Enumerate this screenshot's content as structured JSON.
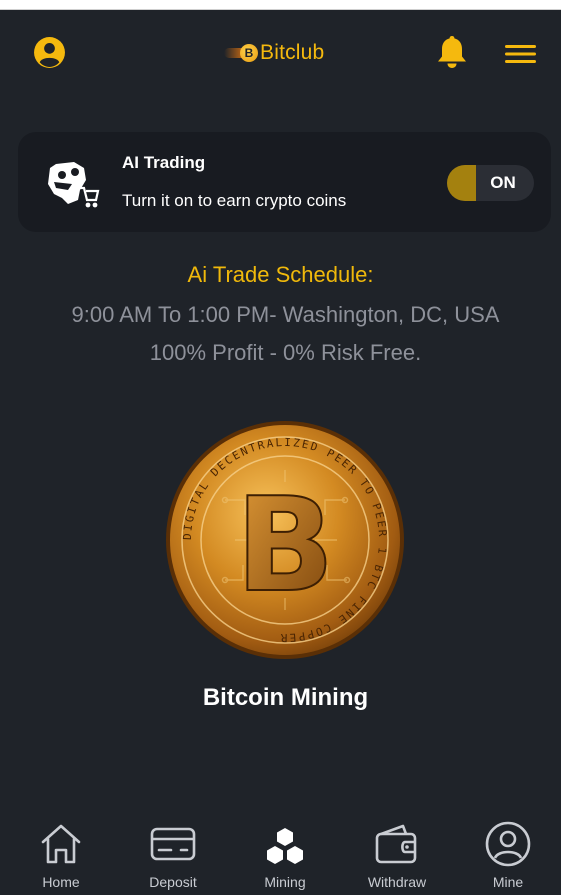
{
  "header": {
    "profile_icon": "user-circle-icon",
    "logo_text": "Bitclub",
    "logo_coin_glyph": "B",
    "notification_icon": "bell-icon",
    "menu_icon": "hamburger-icon"
  },
  "ai_card": {
    "icon": "robot-cart-icon",
    "title": "AI Trading",
    "subtitle": "Turn it on to earn crypto coins",
    "toggle_label": "ON",
    "toggle_on": true
  },
  "schedule": {
    "title": "Ai Trade Schedule:",
    "time": "9:00 AM To 1:00 PM- Washington, DC, USA",
    "profit": "100% Profit - 0% Risk Free."
  },
  "hero": {
    "image": "bitcoin-coin-image",
    "caption": "Bitcoin Mining",
    "coin_glyph": "B",
    "coin_ring_text": "DIGITAL DECENTRALIZED PEER TO PEER 1 BTC FINE COPPER"
  },
  "bottom_nav": [
    {
      "label": "Home",
      "icon": "home-icon"
    },
    {
      "label": "Deposit",
      "icon": "card-icon"
    },
    {
      "label": "Mining",
      "icon": "cubes-icon"
    },
    {
      "label": "Withdraw",
      "icon": "wallet-icon"
    },
    {
      "label": "Mine",
      "icon": "user-circle-icon"
    }
  ],
  "colors": {
    "background": "#1f2329",
    "card": "#181b21",
    "accent": "#f5b90e",
    "muted_text": "#8e919a",
    "toggle_fill": "#a4810f"
  }
}
